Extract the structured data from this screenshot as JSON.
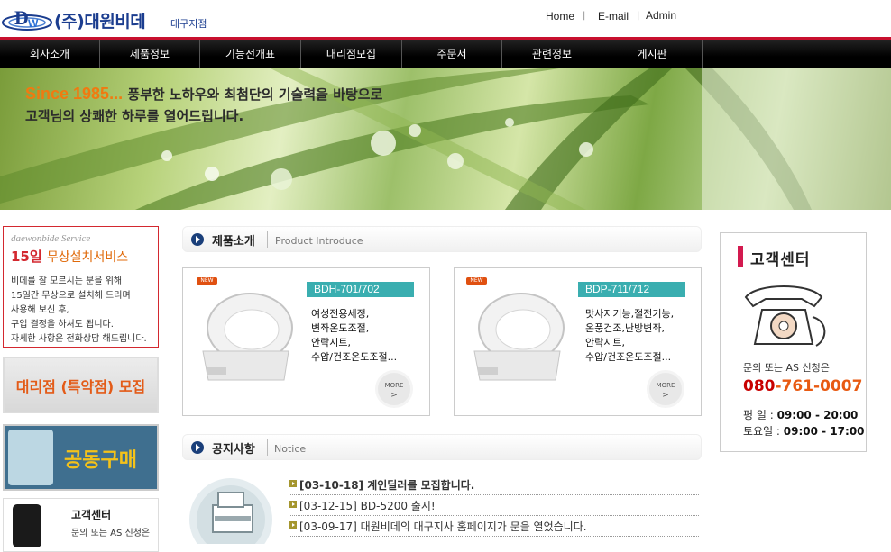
{
  "header": {
    "logo_name": "(주)대원비데",
    "logo_branch": "대구지점",
    "links": [
      "Home",
      "E-mail",
      "Admin"
    ],
    "link_separators": [
      "|",
      "|"
    ]
  },
  "nav": {
    "items": [
      "회사소개",
      "제품정보",
      "기능전개표",
      "대리점모집",
      "주문서",
      "관련정보",
      "게시판"
    ]
  },
  "hero": {
    "since": "Since 1985...",
    "line1": "풍부한 노하우와 최첨단의 기술력을 바탕으로",
    "line2": "고객님의 상쾌한 하루를 열어드립니다."
  },
  "service_box": {
    "en_title": "daewonbide Service",
    "days": "15일",
    "title": "무상설치서비스",
    "lines": [
      "비데를 잘 모르시는 분을 위해",
      "15일간 무상으로 설치해 드리며",
      "사용해 보신 후,",
      "구입 결정을 하셔도 됩니다.",
      "자세한 사항은 전화상담 해드립니다."
    ]
  },
  "dealer_banner": {
    "text": "대리점 (특약점) 모집"
  },
  "group_buy_banner": {
    "text": "공동구매"
  },
  "left_cs": {
    "title": "고객센터",
    "sub": "문의 또는 AS 신청은"
  },
  "product_section": {
    "title": "제품소개",
    "subtitle": "Product Introduce"
  },
  "products": [
    {
      "badge": "NEW",
      "model": "BDH-701/702",
      "features": [
        "여성전용세정,",
        "변좌온도조절,",
        "안락시트,",
        "수압/건조온도조절..."
      ],
      "more_label": "MORE",
      "more_arrow": ">"
    },
    {
      "badge": "NEW",
      "model": "BDP-711/712",
      "features": [
        "맛사지기능,절전기능,",
        "온풍건조,난방변좌,",
        "안락시트,",
        "수압/건조온도조절..."
      ],
      "more_label": "MORE",
      "more_arrow": ">"
    }
  ],
  "notice_section": {
    "title": "공지사항",
    "subtitle": "Notice"
  },
  "notices": [
    {
      "text": "[03-10-18] 계인딜러를 모집합니다.",
      "bold": true
    },
    {
      "text": "[03-12-15] BD-5200 출시!",
      "bold": false
    },
    {
      "text": "[03-09-17] 대원비데의 대구지사 홈페이지가 문을 열었습니다.",
      "bold": false
    }
  ],
  "right_cs": {
    "title": "고객센터",
    "sub": "문의 또는 AS 신청은",
    "phone_prefix": "080",
    "phone_rest": "-761-0007",
    "hours": [
      {
        "label": "평   일 : ",
        "value": "09:00 - 20:00"
      },
      {
        "label": "토요일 : ",
        "value": "09:00 - 17:00"
      }
    ]
  },
  "colors": {
    "accent_red": "#c8102e",
    "brand_blue": "#1b3d8f",
    "teal": "#3aaeb0",
    "orange": "#e85a12"
  }
}
